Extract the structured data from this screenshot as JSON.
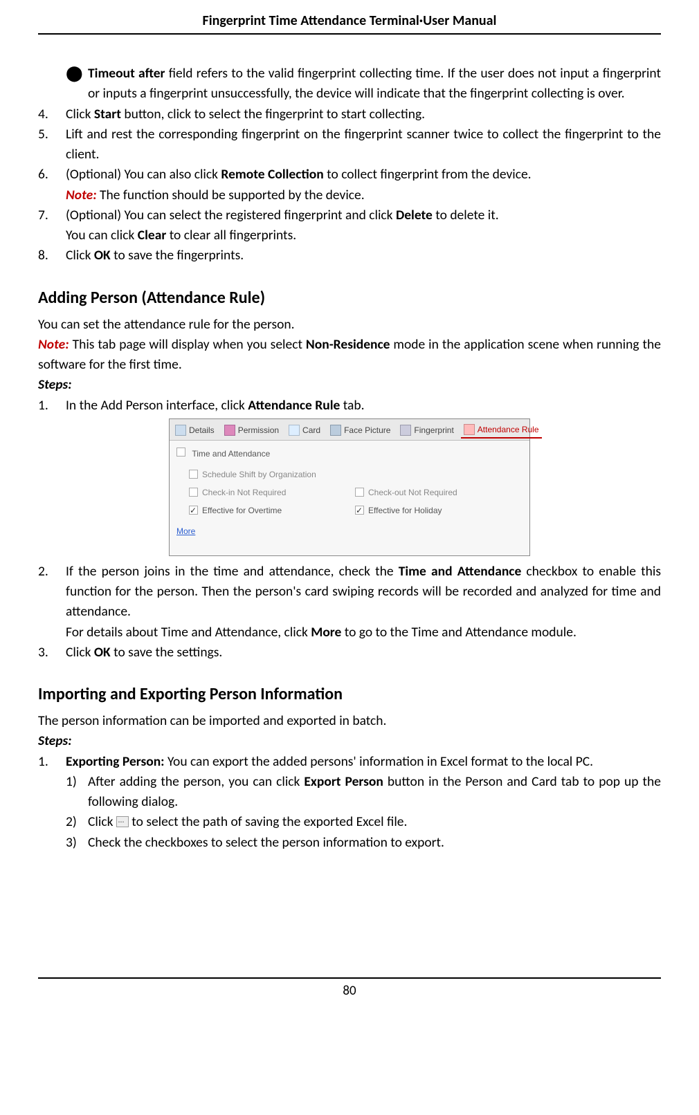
{
  "header": {
    "title": "Fingerprint Time Attendance Terminal·User Manual"
  },
  "page_number": "80",
  "bullet_timeout": {
    "lead": "Timeout after",
    "rest": " field refers to the valid fingerprint collecting time. If the user does not input a fingerprint or inputs a fingerprint unsuccessfully, the device will indicate that the fingerprint collecting is over."
  },
  "step4": {
    "num": "4.",
    "pre": "Click ",
    "b": "Start",
    "post": " button, click to select the fingerprint to start collecting."
  },
  "step5": {
    "num": "5.",
    "text": "Lift and rest the corresponding fingerprint on the fingerprint scanner twice to collect the fingerprint to the client."
  },
  "step6": {
    "num": "6.",
    "pre": "(Optional) You can also click ",
    "b": "Remote Collection",
    "post": " to collect fingerprint from the device."
  },
  "step6_note": {
    "lead": "Note:",
    "rest": " The function should be supported by the device."
  },
  "step7": {
    "num": "7.",
    "pre": "(Optional) You can select the registered fingerprint and click ",
    "b": "Delete",
    "post": " to delete it."
  },
  "step7_extra": {
    "pre": "You can click ",
    "b": "Clear",
    "post": " to clear all fingerprints."
  },
  "step8": {
    "num": "8.",
    "pre": "Click ",
    "b": "OK",
    "post": " to save the fingerprints."
  },
  "sectionA": {
    "title": "Adding Person (Attendance Rule)",
    "intro": "You can set the attendance rule for the person.",
    "note_lead": "Note:",
    "note_pre": " This tab page will display when you select ",
    "note_b": "Non-Residence",
    "note_post": " mode in the application scene when running the software for the first time.",
    "steps_label": "Steps:",
    "s1": {
      "num": "1.",
      "pre": "In the Add Person interface, click ",
      "b": "Attendance Rule",
      "post": " tab."
    },
    "s2": {
      "num": "2.",
      "pre": "If the person joins in the time and attendance, check the ",
      "b": "Time and Attendance",
      "post": " checkbox to enable this function for the person. Then the person's card swiping records will be recorded and analyzed for time and attendance."
    },
    "s2b": {
      "pre": "For details about Time and Attendance, click ",
      "b": "More",
      "post": " to go to the Time and Attendance module."
    },
    "s3": {
      "num": "3.",
      "pre": "Click ",
      "b": "OK",
      "post": " to save the settings."
    }
  },
  "shot": {
    "tabs": {
      "details": "Details",
      "permission": "Permission",
      "card": "Card",
      "face": "Face Picture",
      "fingerprint": "Fingerprint",
      "rule": "Attendance Rule"
    },
    "panel_title": "Time and Attendance",
    "opt_schedule": "Schedule Shift by Organization",
    "opt_checkin": "Check-in Not Required",
    "opt_checkout": "Check-out Not Required",
    "opt_overtime": "Effective for Overtime",
    "opt_holiday": "Effective for Holiday",
    "more": "More"
  },
  "sectionB": {
    "title": "Importing and Exporting Person Information",
    "intro": "The person information can be imported and exported in batch.",
    "steps_label": "Steps:",
    "s1": {
      "num": "1.",
      "lead": "Exporting Person:",
      "rest": " You can export the added persons' information in Excel format to the local PC."
    },
    "sub1": {
      "num": "1)",
      "pre": "After adding the person, you can click ",
      "b": "Export Person",
      "post": " button in the Person and Card tab to pop up the following dialog."
    },
    "sub2": {
      "num": "2)",
      "pre": "Click ",
      "post": " to select the path of saving the exported Excel file."
    },
    "sub3": {
      "num": "3)",
      "text": "Check the checkboxes to select the person information to export."
    }
  }
}
